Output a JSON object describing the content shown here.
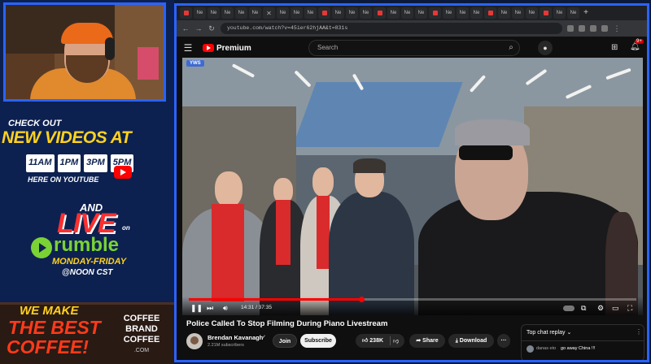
{
  "overlay": {
    "check_out": "CHECK OUT",
    "new_videos_at": "NEW VIDEOS AT",
    "times": [
      "11AM",
      "1PM",
      "3PM",
      "5PM"
    ],
    "here_on_youtube": "HERE ON YOUTUBE",
    "and": "AND",
    "live": "LIVE",
    "on": "on",
    "rumble": "rumble",
    "monday_friday": "MONDAY-FRIDAY",
    "noon_cst": "@NOON CST",
    "we_make": "WE MAKE",
    "the_best": "THE BEST",
    "coffee": "COFFEE!",
    "brand_line1": "COFFEE",
    "brand_line2": "BRAND",
    "brand_line3": "COFFEE",
    "brand_dot": ".COM"
  },
  "browser": {
    "tab_label": "Ne",
    "url": "youtube.com/watch?v=45ier62hjAA&t=831s",
    "new_tab": "+"
  },
  "youtube": {
    "brand": "Premium",
    "search_placeholder": "Search",
    "notifications_count": "9+",
    "video_badge": "YWS",
    "current_time": "14:31 / 37:35",
    "progress": 0.386,
    "title": "Police Called To Stop Filming During Piano Livestream",
    "channel": "Brendan Kavanagh",
    "subscribers": "2.21M subscribers",
    "join": "Join",
    "subscribe": "Subscribe",
    "likes": "238K",
    "share": "Share",
    "download": "Download",
    "more": "···"
  },
  "chat": {
    "header": "Top chat replay",
    "messages": [
      {
        "user": "danas eto",
        "text": "go away China !!!"
      }
    ]
  },
  "colors": {
    "frame_blue": "#2b63ff",
    "yt_red": "#ff0000",
    "new_videos_yellow": "#ffd21e",
    "rumble_green": "#7ad235",
    "live_red": "#ff2f2f"
  }
}
